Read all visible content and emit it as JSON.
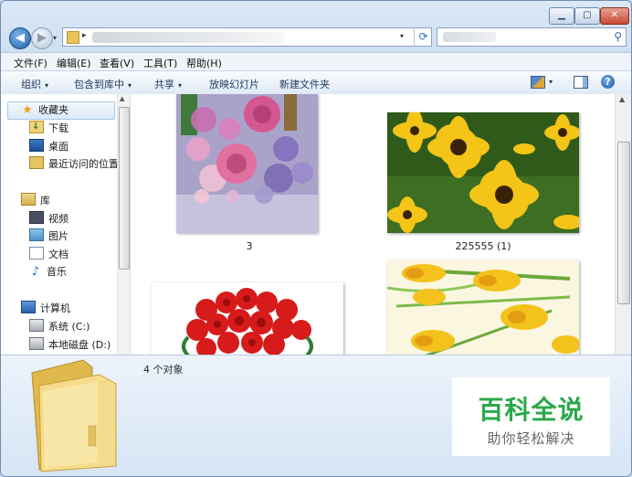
{
  "window": {
    "controls": {
      "minimize": "▁",
      "maximize": "▢",
      "close": "✕"
    }
  },
  "nav": {
    "back": "◀",
    "forward": "▶",
    "history": "▾"
  },
  "address": {
    "separator": "▸",
    "dropdown": "▾",
    "refresh": "⟳"
  },
  "search": {
    "icon": "⚲"
  },
  "menu": {
    "file": "文件(F)",
    "edit": "编辑(E)",
    "view": "查看(V)",
    "tools": "工具(T)",
    "help": "帮助(H)"
  },
  "toolbar": {
    "organize": "组织",
    "include_library": "包含到库中",
    "share": "共享",
    "slideshow": "放映幻灯片",
    "new_folder": "新建文件夹",
    "dropdown": "▾",
    "views_dropdown": "▾",
    "help": "?"
  },
  "sidebar": {
    "favorites": "收藏夹",
    "downloads": "下载",
    "desktop": "桌面",
    "recent": "最近访问的位置",
    "libraries": "库",
    "videos": "视频",
    "pictures": "图片",
    "documents": "文档",
    "music": "音乐",
    "computer": "计算机",
    "drive_c": "系统 (C:)",
    "drive_d": "本地磁盘 (D:)",
    "star": "★",
    "music_note": "♪"
  },
  "scroll": {
    "up": "▲"
  },
  "files": [
    {
      "caption": "3"
    },
    {
      "caption": "225555 (1)"
    }
  ],
  "details": {
    "count": "4 个对象"
  },
  "watermark": {
    "title": "百科全说",
    "subtitle": "助你轻松解决"
  },
  "colors": {
    "accent": "#2aa84a",
    "window_frame": "#c7dbef",
    "selection": "#dce9f8"
  }
}
